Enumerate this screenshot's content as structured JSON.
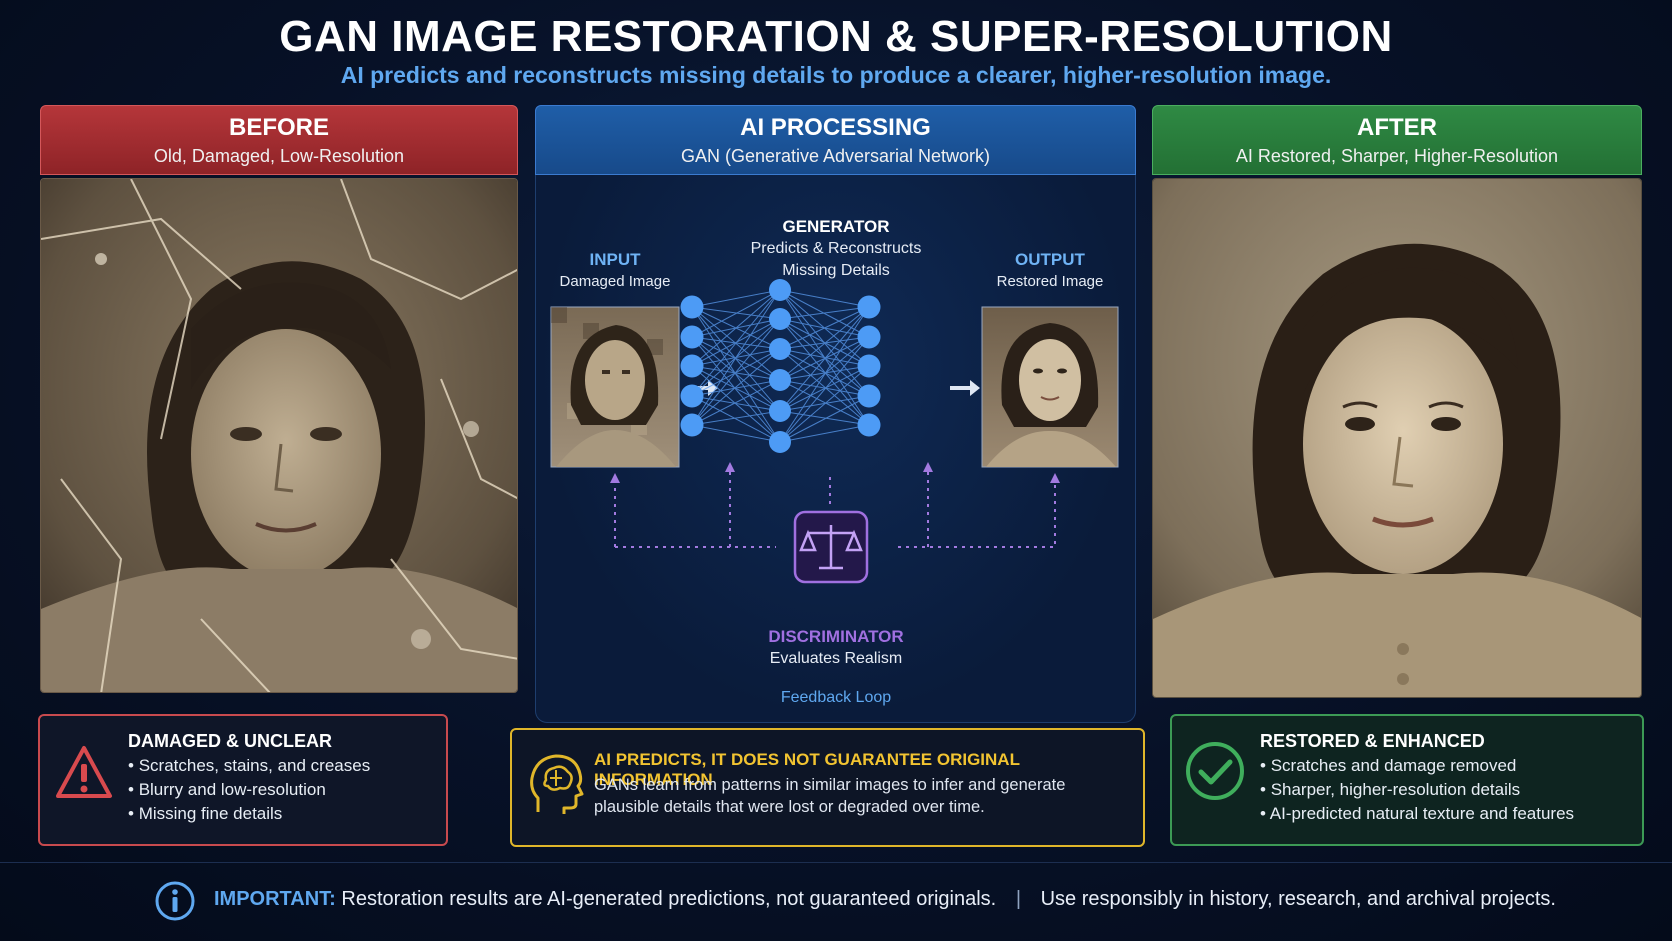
{
  "header": {
    "title": "GAN IMAGE RESTORATION & SUPER-RESOLUTION",
    "subtitle": "AI predicts and reconstructs missing details to produce a clearer, higher-resolution image."
  },
  "before": {
    "heading": "BEFORE",
    "subheading": "Old, Damaged, Low-Resolution",
    "box_title": "DAMAGED & UNCLEAR",
    "bullets": [
      "Scratches, stains, and creases",
      "Blurry and low-resolution",
      "Missing fine details"
    ]
  },
  "ai": {
    "heading": "AI PROCESSING",
    "subheading": "GAN (Generative Adversarial Network)",
    "input_title": "INPUT",
    "input_sub": "Damaged Image",
    "generator_title": "GENERATOR",
    "generator_sub1": "Predicts & Reconstructs",
    "generator_sub2": "Missing Details",
    "output_title": "OUTPUT",
    "output_sub": "Restored Image",
    "discriminator_title": "DISCRIMINATOR",
    "discriminator_sub": "Evaluates Realism",
    "feedback": "Feedback Loop"
  },
  "after": {
    "heading": "AFTER",
    "subheading": "AI Restored, Sharper, Higher-Resolution",
    "box_title": "RESTORED & ENHANCED",
    "bullets": [
      "Scratches and damage removed",
      "Sharper, higher-resolution details",
      "AI-predicted natural texture and features"
    ]
  },
  "notice": {
    "title": "AI PREDICTS, IT DOES NOT GUARANTEE ORIGINAL INFORMATION",
    "line1": "GANs learn from patterns in similar images to infer and generate",
    "line2": "plausible details that were lost or degraded over time."
  },
  "footer": {
    "important_label": "IMPORTANT:",
    "text1": "Restoration results are AI-generated predictions, not guaranteed originals.",
    "separator": "|",
    "text2": "Use responsibly in history, research, and archival projects."
  },
  "colors": {
    "before_red": "#b5363a",
    "ai_blue": "#1f5ea8",
    "after_green": "#2f8a44",
    "accent_blue": "#5fa8f0",
    "warning_yellow": "#f2c431",
    "discriminator_purple": "#a070e0"
  },
  "icons": [
    "warning-triangle-icon",
    "brain-head-icon",
    "check-circle-icon",
    "info-icon",
    "balance-scale-icon"
  ]
}
